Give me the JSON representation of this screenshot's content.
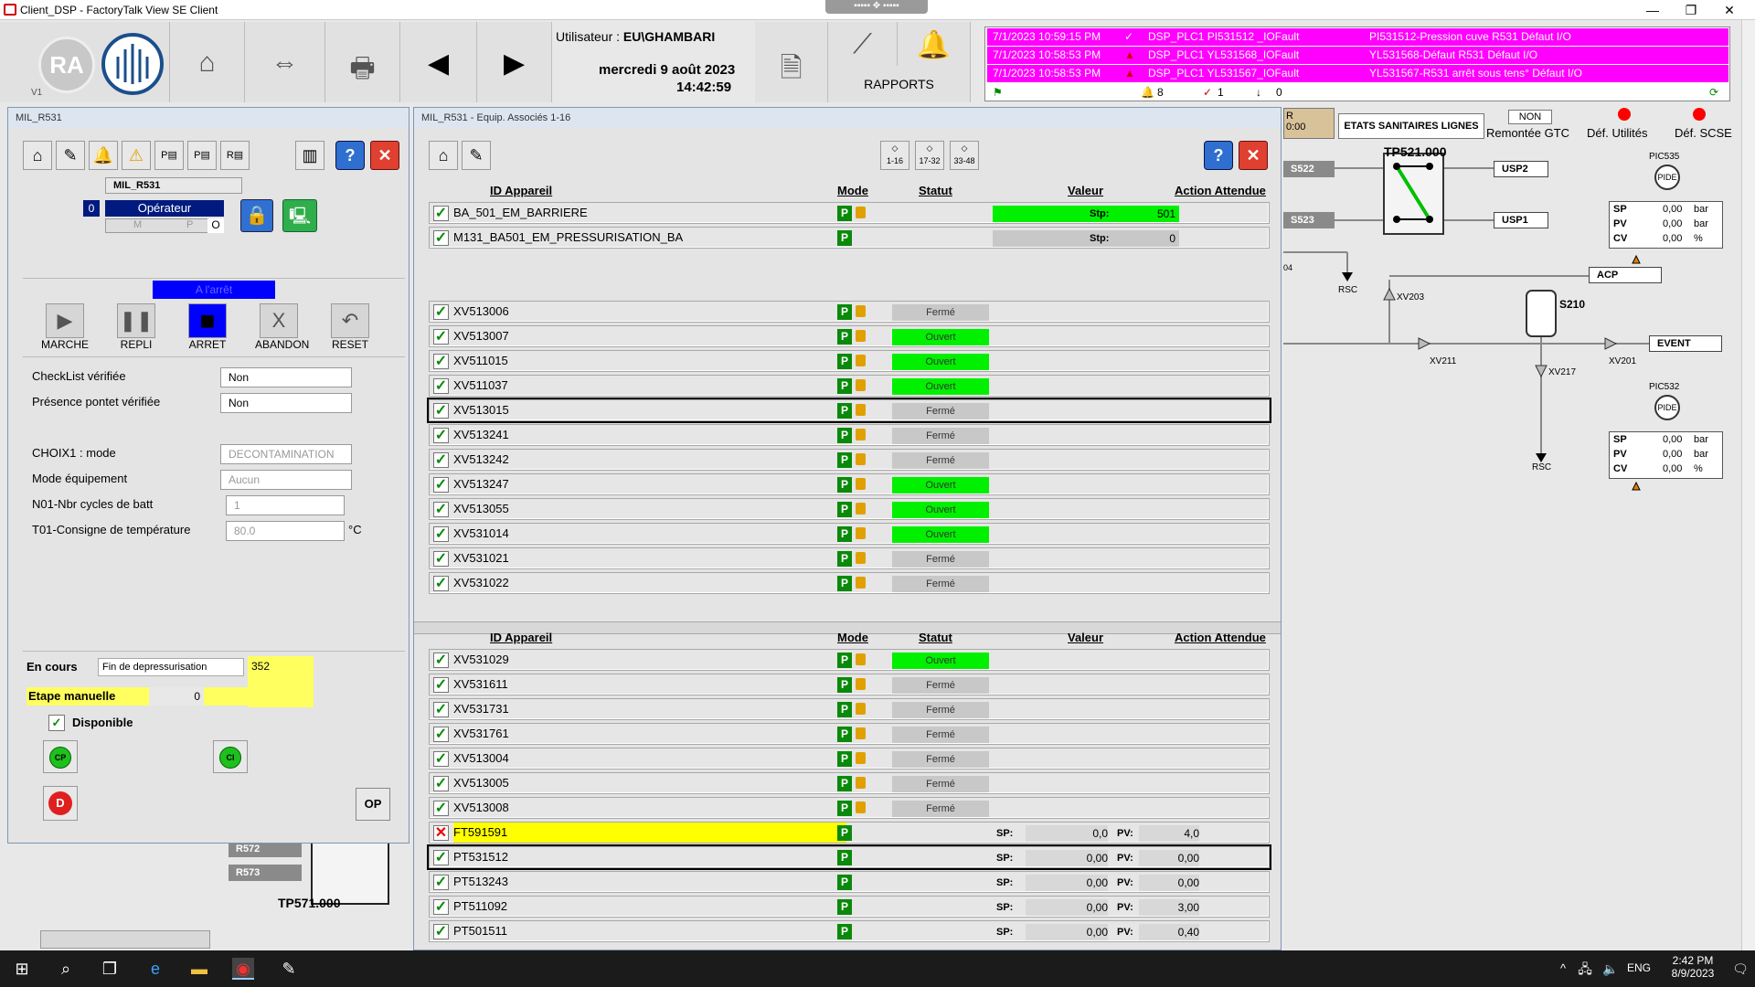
{
  "window": {
    "title": "Client_DSP - FactoryTalk View SE Client",
    "menu_handle": "▪▪▪▪▪ ✥ ▪▪▪▪▪",
    "min": "—",
    "max": "❐",
    "close": "✕"
  },
  "header": {
    "logo_ra": "RA",
    "version": "V1",
    "user_label": "Utilisateur :",
    "user_value": "EU\\GHAMBARI",
    "date": "mercredi 9 août 2023",
    "time": "14:42:59",
    "reports_label": "RAPPORTS"
  },
  "alarms": [
    {
      "time": "7/1/2023 10:59:15 PM",
      "source": "DSP_PLC1 PI531512 _IOFault",
      "message": "PI531512-Pression cuve R531 Défaut I/O"
    },
    {
      "time": "7/1/2023 10:58:53 PM",
      "source": "DSP_PLC1 YL531568_IOFault",
      "message": "YL531568-Défaut R531 Défaut I/O"
    },
    {
      "time": "7/1/2023 10:58:53 PM",
      "source": "DSP_PLC1 YL531567_IOFault",
      "message": "YL531567-R531 arrêt sous tens° Défaut I/O"
    }
  ],
  "alarm_counts": {
    "active": "8",
    "ack": "1",
    "other": "0"
  },
  "left": {
    "title": "MIL_R531",
    "unit": "MIL_R531",
    "mode_num": "0",
    "operator": "Opérateur",
    "m": "M",
    "p": "P",
    "o": "O",
    "state": "A l'arrêt",
    "controls": [
      "MARCHE",
      "REPLI",
      "ARRET",
      "ABANDON",
      "RESET"
    ],
    "fields": [
      {
        "label": "CheckList vérifiée",
        "value": "Non"
      },
      {
        "label": "Présence pontet vérifiée",
        "value": "Non"
      },
      {
        "label": "CHOIX1 : mode",
        "value": "DECONTAMINATION"
      },
      {
        "label": "Mode équipement",
        "value": "Aucun"
      },
      {
        "label": "N01-Nbr cycles de batt",
        "value": "1"
      },
      {
        "label": "T01-Consigne de température",
        "value": "80.0",
        "unit": "°C"
      }
    ],
    "en_cours_label": "En cours",
    "en_cours_value": "Fin de depressurisation",
    "en_cours_num": "352",
    "etape_label": "Etape manuelle",
    "etape_value": "0",
    "disponible": "Disponible",
    "op": "OP",
    "cp": "CP",
    "ci": "CI",
    "d": "D"
  },
  "below_left": {
    "r572": "R572",
    "r573": "R573",
    "tp": "TP571.000"
  },
  "mid": {
    "title": "MIL_R531 - Equip. Associés 1-16",
    "pages": [
      "1-16",
      "17-32",
      "33-48"
    ],
    "headers": {
      "id": "ID Appareil",
      "mode": "Mode",
      "statut": "Statut",
      "valeur": "Valeur",
      "action": "Action Attendue"
    },
    "top_rows": [
      {
        "id": "BA_501_EM_BARRIERE",
        "stp": "Stp:",
        "value": "501"
      },
      {
        "id": "M131_BA501_EM_PRESSURISATION_BA",
        "stp": "Stp:",
        "value": "0"
      }
    ],
    "valves_a": [
      {
        "id": "XV513006",
        "status": "Fermé"
      },
      {
        "id": "XV513007",
        "status": "Ouvert"
      },
      {
        "id": "XV511015",
        "status": "Ouvert"
      },
      {
        "id": "XV511037",
        "status": "Ouvert"
      },
      {
        "id": "XV513015",
        "status": "Fermé"
      },
      {
        "id": "XV513241",
        "status": "Fermé"
      },
      {
        "id": "XV513242",
        "status": "Fermé"
      },
      {
        "id": "XV513247",
        "status": "Ouvert"
      },
      {
        "id": "XV513055",
        "status": "Ouvert"
      },
      {
        "id": "XV531014",
        "status": "Ouvert"
      },
      {
        "id": "XV531021",
        "status": "Fermé"
      },
      {
        "id": "XV531022",
        "status": "Fermé"
      }
    ],
    "valves_b": [
      {
        "id": "XV531029",
        "status": "Ouvert"
      },
      {
        "id": "XV531611",
        "status": "Fermé"
      },
      {
        "id": "XV531731",
        "status": "Fermé"
      },
      {
        "id": "XV531761",
        "status": "Fermé"
      },
      {
        "id": "XV513004",
        "status": "Fermé"
      },
      {
        "id": "XV513005",
        "status": "Fermé"
      },
      {
        "id": "XV513008",
        "status": "Fermé"
      }
    ],
    "sensors": [
      {
        "id": "FT591591",
        "sp": "0,0",
        "pv": "4,0"
      },
      {
        "id": "PT531512",
        "sp": "0,00",
        "pv": "0,00"
      },
      {
        "id": "PT513243",
        "sp": "0,00",
        "pv": "0,00"
      },
      {
        "id": "PT511092",
        "sp": "0,00",
        "pv": "3,00"
      },
      {
        "id": "PT501511",
        "sp": "0,00",
        "pv": "0,40"
      }
    ],
    "sp": "SP:",
    "pv": "PV:",
    "p": "P"
  },
  "right": {
    "r_label": "R",
    "r_time": "0:00",
    "etats": "ETATS SANITAIRES LIGNES",
    "non": "NON",
    "remontee": "Remontée GTC",
    "def_util": "Déf. Utilités",
    "def_scse": "Déf. SCSE",
    "tp": "TP521.000",
    "s522": "S522",
    "s523": "S523",
    "usp2": "USP2",
    "usp1": "USP1",
    "rsc": "RSC",
    "acp": "ACP",
    "event": "EVENT",
    "s210": "S210",
    "xv203": "XV203",
    "xv211": "XV211",
    "xv217": "XV217",
    "xv201": "XV201",
    "s": "S",
    "n04": "04",
    "pic535": {
      "name": "PIC535",
      "sp": "0,00",
      "pv": "0,00",
      "cv": "0,00",
      "u1": "bar",
      "u3": "%"
    },
    "pic532": {
      "name": "PIC532",
      "sp": "0,00",
      "pv": "0,00",
      "cv": "0,00",
      "u1": "bar",
      "u3": "%"
    },
    "pide": "PIDE",
    "m": "M",
    "sp_l": "SP",
    "pv_l": "PV",
    "cv_l": "CV"
  },
  "taskbar": {
    "time": "2:42 PM",
    "date": "8/9/2023",
    "lang": "ENG"
  }
}
